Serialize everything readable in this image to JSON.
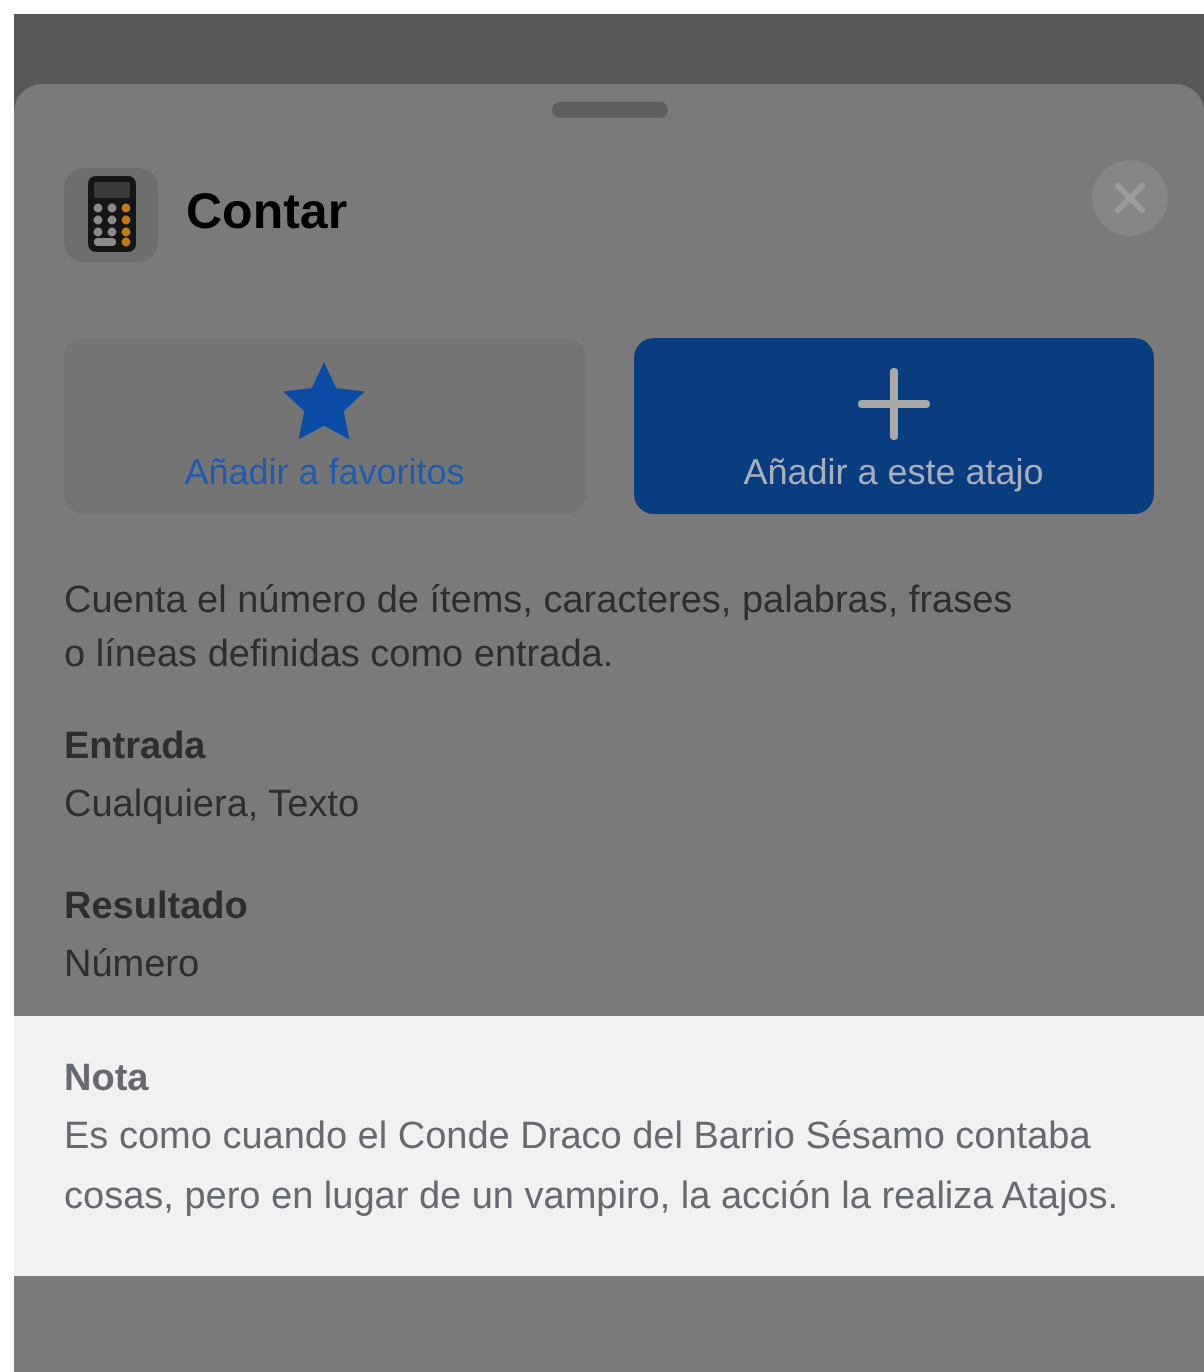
{
  "sheet": {
    "title": "Contar"
  },
  "buttons": [
    {
      "label": "Añadir a favoritos",
      "kind": "secondary"
    },
    {
      "label": "Añadir a este atajo",
      "kind": "primary"
    }
  ],
  "description": "Cuenta el número de ítems, caracteres, palabras, frases o líneas definidas como entrada.",
  "sections": [
    {
      "heading": "Entrada",
      "text": "Cualquiera, Texto",
      "highlighted": false
    },
    {
      "heading": "Resultado",
      "text": "Número",
      "highlighted": false
    },
    {
      "heading": "Nota",
      "text": "Es como cuando el Conde Draco del Barrio Sésamo contaba cosas, pero en lugar de un vampiro, la acción la realiza Atajos.",
      "highlighted": true
    }
  ]
}
